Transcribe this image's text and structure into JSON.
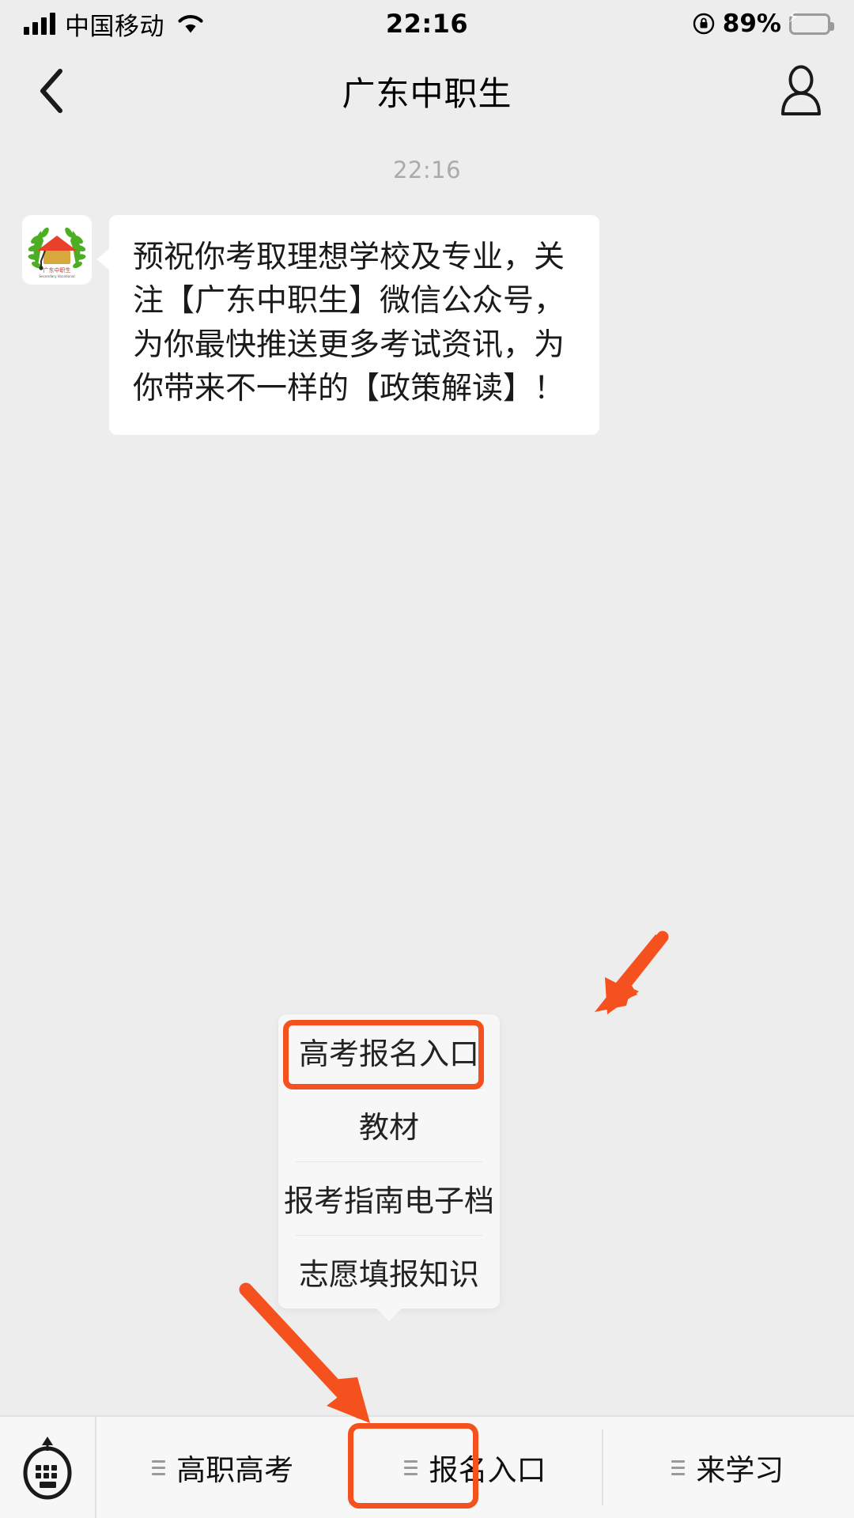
{
  "status_bar": {
    "carrier": "中国移动",
    "time": "22:16",
    "battery_percent": "89%",
    "signal_icon": "signal-bars-icon",
    "wifi_icon": "wifi-icon",
    "rotation_lock_icon": "rotation-lock-icon",
    "battery_icon": "battery-charging-icon",
    "charging_bolt": "⚡"
  },
  "nav_bar": {
    "title": "广东中职生",
    "back_icon": "back-chevron-icon",
    "profile_icon": "contact-profile-icon"
  },
  "chat": {
    "timestamp": "22:16",
    "message": {
      "avatar_icon": "official-account-avatar-laurel-graduation-cap",
      "text": "预祝你考取理想学校及专业，关注【广东中职生】微信公众号，为你最快推送更多考试资讯，为你带来不一样的【政策解读】！"
    }
  },
  "menu_popup": {
    "items": [
      {
        "label": "高考报名入口",
        "highlighted": true
      },
      {
        "label": "教材",
        "highlighted": false
      },
      {
        "label": "报考指南电子档",
        "highlighted": false
      },
      {
        "label": "志愿填报知识",
        "highlighted": false
      }
    ]
  },
  "tab_bar": {
    "keyboard_button_icon": "keyboard-toggle-icon",
    "tabs": [
      {
        "label": "高职高考",
        "icon": "list-menu-icon",
        "active": false
      },
      {
        "label": "报名入口",
        "icon": "list-menu-icon",
        "active": true
      },
      {
        "label": "来学习",
        "icon": "list-menu-icon",
        "active": false
      }
    ]
  },
  "annotations": {
    "highlight_color": "#f4511e",
    "arrow_1_icon": "arrow-pointing-down-left-icon",
    "arrow_2_icon": "arrow-pointing-down-right-icon"
  }
}
